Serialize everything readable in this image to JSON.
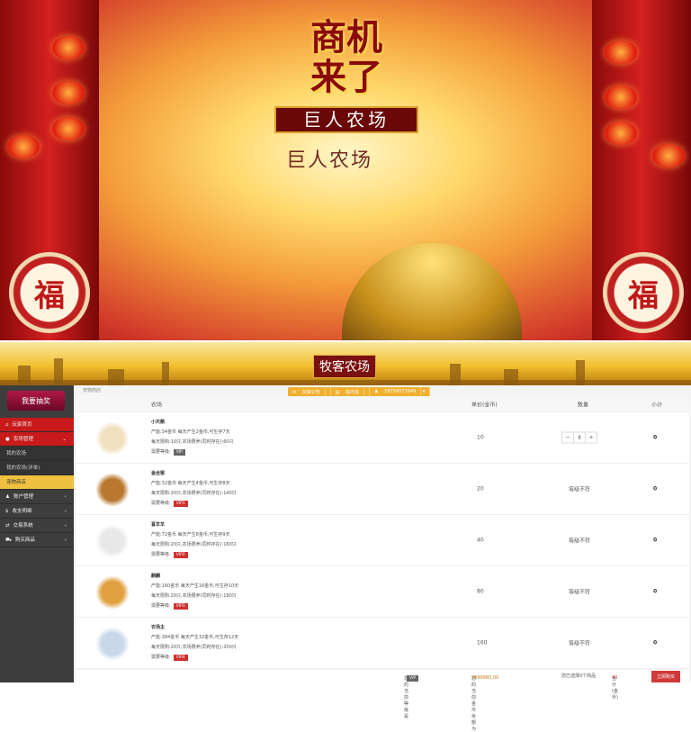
{
  "banner": {
    "title_line1": "商机",
    "title_line2": "来了",
    "subtitle": "巨人农场",
    "subtitle_echo": "巨人农场",
    "drum_char": "福"
  },
  "header": {
    "logo": "牧客农场"
  },
  "sidebar": {
    "lottery": "我要抽奖",
    "items": [
      {
        "label": "玩家首页",
        "icon": "home-icon"
      },
      {
        "label": "农场管理",
        "icon": "farm-icon"
      },
      {
        "label": "我的农场"
      },
      {
        "label": "我的农场(详单)"
      },
      {
        "label": "宠物商店"
      },
      {
        "label": "账户管理",
        "icon": "user-icon"
      },
      {
        "label": "收支明细",
        "icon": "dollar-icon"
      },
      {
        "label": "交易系统",
        "icon": "exchange-icon"
      },
      {
        "label": "购买商品",
        "icon": "cart-icon"
      }
    ]
  },
  "main": {
    "breadcrumb": "宠物商店",
    "tools": [
      "玩家公告",
      "站内信",
      "18756071049"
    ],
    "columns": [
      "农场",
      "单价(金币)",
      "数量",
      "小计"
    ],
    "level_label": "需要等级:",
    "rows": [
      {
        "name": "小天鹅",
        "line1": "产能:34金币 每天产生2金币,可生存7天",
        "line2": "每天限购:10只,农场限养(同时存在):60只",
        "vip": "VIP",
        "price": "10",
        "qty": "0",
        "subtotal": "0",
        "color": "#f0e0c0"
      },
      {
        "name": "金丝猴",
        "line1": "产能:32金币 每天产生4金币,可生存8天",
        "line2": "每天限购:20只,农场限养(同时存在):140只",
        "vip": "VIP1",
        "price": "20",
        "status": "等级不符",
        "subtotal": "0",
        "color": "#b87830"
      },
      {
        "name": "喜羊羊",
        "line1": "产能:72金币 每天产生8金币,可生存9天",
        "line2": "每天限购:20只,农场限养(同时存在):160只",
        "vip": "VIP2",
        "price": "40",
        "status": "等级不符",
        "subtotal": "0",
        "color": "#e8e8e8"
      },
      {
        "name": "麒麟",
        "line1": "产能:160金币 每天产生16金币,可生存10天",
        "line2": "每天限购:20只,农场限养(同时存在):180只",
        "vip": "VIP3",
        "price": "80",
        "status": "等级不符",
        "subtotal": "0",
        "color": "#e0a040"
      },
      {
        "name": "农场主",
        "line1": "产能:384金币 每天产生32金币,可生存12天",
        "line2": "每天限购:20只,农场限养(同时存在):200只",
        "vip": "VIP4",
        "price": "160",
        "status": "等级不符",
        "subtotal": "0",
        "color": "#c8d8e8"
      }
    ]
  },
  "footer": {
    "level_text": "您的当前等级是",
    "level": "VIP",
    "balance_text": "您的当前金币余额为",
    "balance": "¥999985.00",
    "selected": "您已选择0个商品",
    "total_text": "合计(金币)",
    "total": "¥0",
    "buy": "立即购买"
  }
}
